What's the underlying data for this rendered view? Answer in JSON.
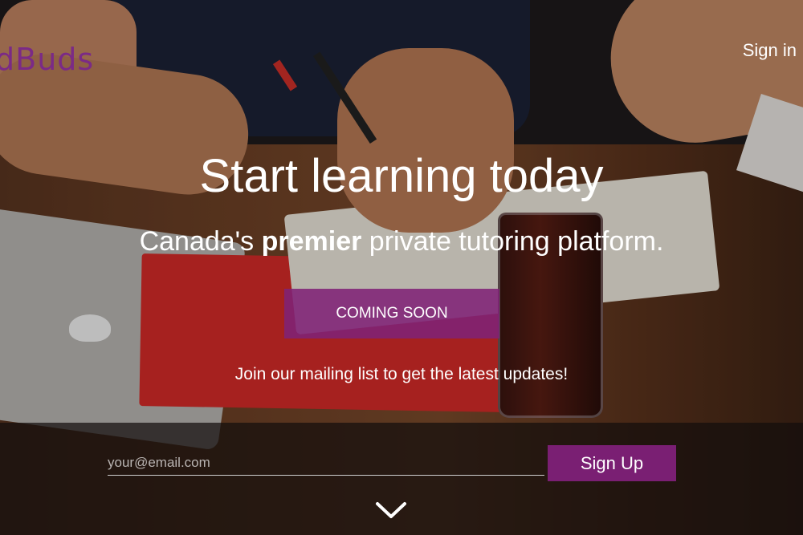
{
  "brand": {
    "name": "dBuds",
    "color": "#7b2a86"
  },
  "nav": {
    "signin_label": "Sign in"
  },
  "hero": {
    "headline": "Start learning today",
    "sub_prefix": "Canada's ",
    "sub_bold": "premier",
    "sub_suffix": " private tutoring platform.",
    "coming_soon_label": "COMING SOON",
    "accent": "#7a1f73"
  },
  "mailing": {
    "text": "Join our mailing list to get the latest updates!",
    "email_placeholder": "your@email.com",
    "email_value": "",
    "signup_label": "Sign Up"
  },
  "icons": {
    "scroll_down": "chevron-down-icon"
  }
}
